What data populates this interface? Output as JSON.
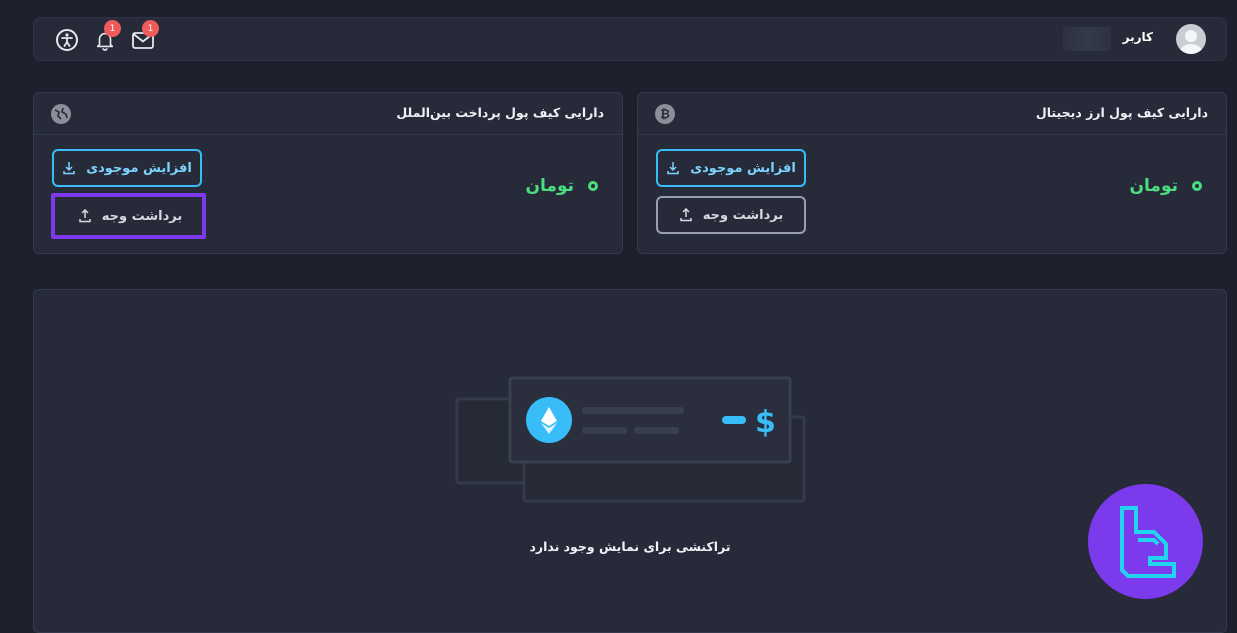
{
  "topbar": {
    "accessibility_icon": "accessibility-icon",
    "notifications": {
      "icon": "bell-icon",
      "count": "1"
    },
    "messages": {
      "icon": "mail-icon",
      "count": "1"
    },
    "user": {
      "label": "کاربر",
      "avatar_icon": "user-avatar-icon"
    }
  },
  "wallets": [
    {
      "title": "دارایی کیف پول ارز دیجیتال",
      "icon": "bitcoin-icon",
      "currency": "تومان",
      "deposit_label": "افزایش موجودی",
      "withdraw_label": "برداشت وجه"
    },
    {
      "title": "دارایی کیف پول پرداخت بین‌الملل",
      "icon": "globe-icon",
      "currency": "تومان",
      "deposit_label": "افزایش موجودی",
      "withdraw_label": "برداشت وجه"
    }
  ],
  "transactions": {
    "empty_message": "تراکنشی برای نمایش وجود ندارد",
    "illustration_symbol": "$"
  },
  "colors": {
    "background": "#1d212d",
    "card": "#272b39",
    "accent": "#38bdf8",
    "positive": "#4ade80",
    "badge": "#ef5b5b",
    "highlight": "#7c3aed"
  }
}
